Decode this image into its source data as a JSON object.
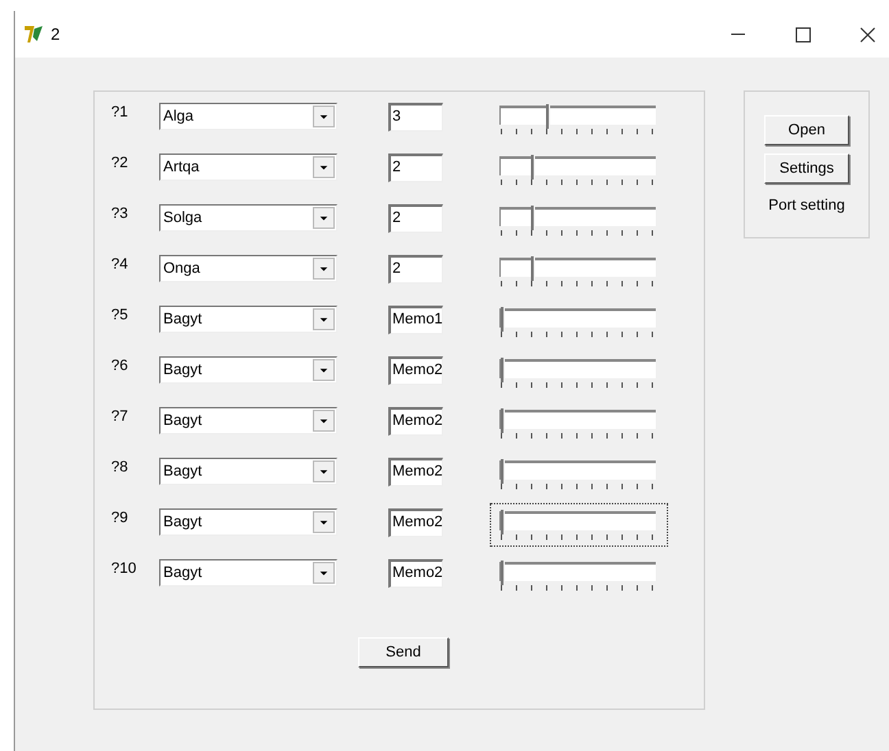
{
  "window": {
    "title": "2"
  },
  "rows": [
    {
      "label": "?1",
      "combo": "Alga",
      "value": "3",
      "level": 0.3,
      "focused": false
    },
    {
      "label": "?2",
      "combo": "Artqa",
      "value": "2",
      "level": 0.2,
      "focused": false
    },
    {
      "label": "?3",
      "combo": "Solga",
      "value": "2",
      "level": 0.2,
      "focused": false
    },
    {
      "label": "?4",
      "combo": "Onga",
      "value": "2",
      "level": 0.2,
      "focused": false
    },
    {
      "label": "?5",
      "combo": "Bagyt",
      "value": "Memo1",
      "level": 0,
      "focused": false
    },
    {
      "label": "?6",
      "combo": "Bagyt",
      "value": "Memo2",
      "level": 0,
      "focused": false
    },
    {
      "label": "?7",
      "combo": "Bagyt",
      "value": "Memo2",
      "level": 0,
      "focused": false
    },
    {
      "label": "?8",
      "combo": "Bagyt",
      "value": "Memo2",
      "level": 0,
      "focused": false
    },
    {
      "label": "?9",
      "combo": "Bagyt",
      "value": "Memo2",
      "level": 0,
      "focused": true
    },
    {
      "label": "?10",
      "combo": "Bagyt",
      "value": "Memo2",
      "level": 0,
      "focused": false
    }
  ],
  "send_button": "Send",
  "port_panel": {
    "buttons": [
      "Open",
      "Settings"
    ],
    "caption": "Port setting"
  }
}
